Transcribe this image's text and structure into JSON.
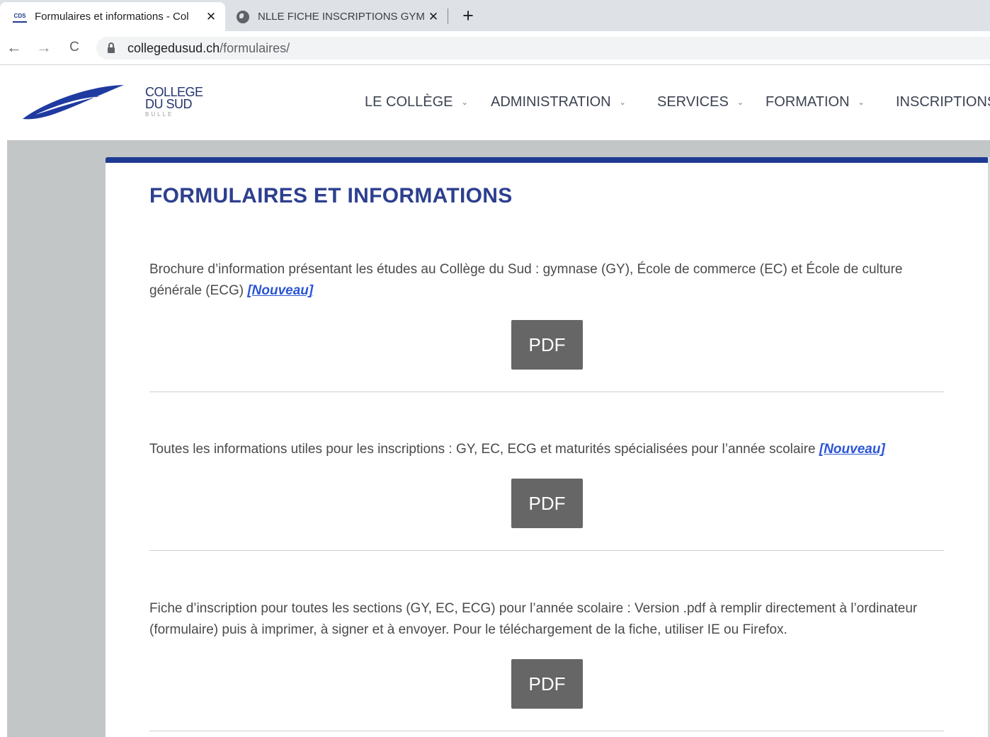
{
  "browser": {
    "tabs": [
      {
        "favicon": "cds-favicon-icon",
        "title": "Formulaires et informations - Col",
        "close": "✕",
        "active": true
      },
      {
        "favicon": "globe-icon",
        "title": "NLLE FICHE INSCRIPTIONS GYMN",
        "close": "✕",
        "active": false
      }
    ],
    "new_tab": "+",
    "nav": {
      "back": "←",
      "forward": "→",
      "reload": "C"
    },
    "address": {
      "host": "collegedusud.ch",
      "path": "/formulaires/"
    }
  },
  "site": {
    "brand": {
      "line1": "COLLEGE",
      "line2": "DU SUD",
      "city": "BULLE"
    },
    "menu": [
      {
        "label": "LE COLLÈGE",
        "chevron": "⌄"
      },
      {
        "label": "ADMINISTRATION",
        "chevron": "⌄"
      },
      {
        "label": "SERVICES",
        "chevron": "⌄"
      },
      {
        "label": "FORMATION",
        "chevron": "⌄"
      },
      {
        "label": "INSCRIPTIONS",
        "chevron": ""
      }
    ]
  },
  "page": {
    "title": "FORMULAIRES ET INFORMATIONS",
    "sections": [
      {
        "text": "Brochure d’information présentant les études au Collège du Sud : gymnase (GY), École de commerce (EC) et École de culture générale (ECG) ",
        "badge": "[Nouveau]",
        "button": "PDF"
      },
      {
        "text": "Toutes les informations utiles pour les inscriptions : GY, EC, ECG et maturités spécialisées pour l’année scolaire ",
        "badge": "[Nouveau]",
        "button": "PDF"
      },
      {
        "text": "Fiche d’inscription pour toutes les sections (GY, EC, ECG) pour l’année scolaire : Version .pdf à remplir directement à l’ordinateur (formulaire) puis à imprimer, à signer et à envoyer. Pour le téléchargement de la fiche, utiliser IE ou Firefox.",
        "badge": "",
        "button": "PDF"
      }
    ]
  },
  "colors": {
    "accent": "#1f3a93",
    "title": "#2d3f8f",
    "badge": "#2b55d6",
    "button": "#666666",
    "page_bg": "#c3c6c7"
  }
}
